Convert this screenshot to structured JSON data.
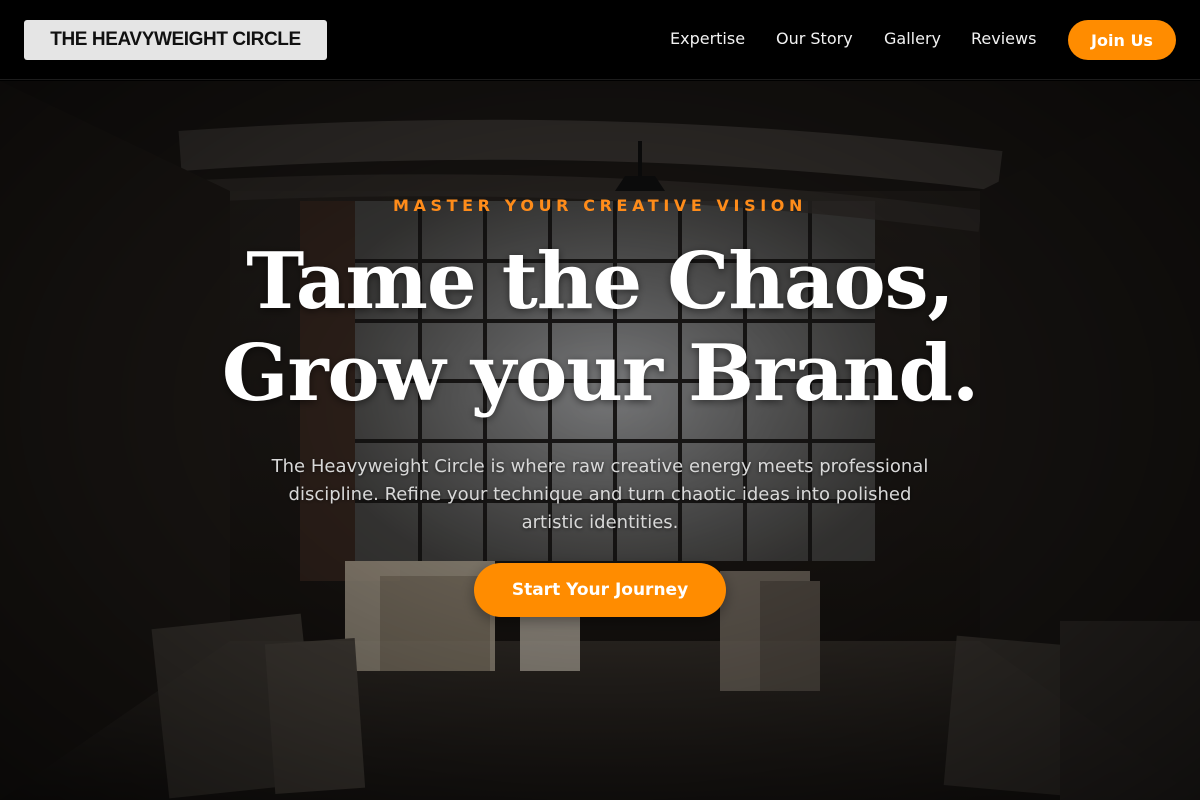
{
  "nav": {
    "logo": "THE HEAVYWEIGHT CIRCLE",
    "links": [
      "Expertise",
      "Our Story",
      "Gallery",
      "Reviews"
    ],
    "cta": "Join Us"
  },
  "hero": {
    "eyebrow": "MASTER YOUR CREATIVE VISION",
    "headline_line1": "Tame the Chaos,",
    "headline_line2": "Grow your Brand.",
    "subtext": "The Heavyweight Circle is where raw creative energy meets professional discipline. Refine your technique and turn chaotic ideas into polished artistic identities.",
    "cta": "Start Your Journey",
    "background": "dim industrial art studio with large windows, ducts, and stacked canvases"
  },
  "colors": {
    "accent": "#ff8c00",
    "nav_bg": "#000000",
    "logo_bg": "#e5e5e5",
    "text": "#ffffff"
  }
}
